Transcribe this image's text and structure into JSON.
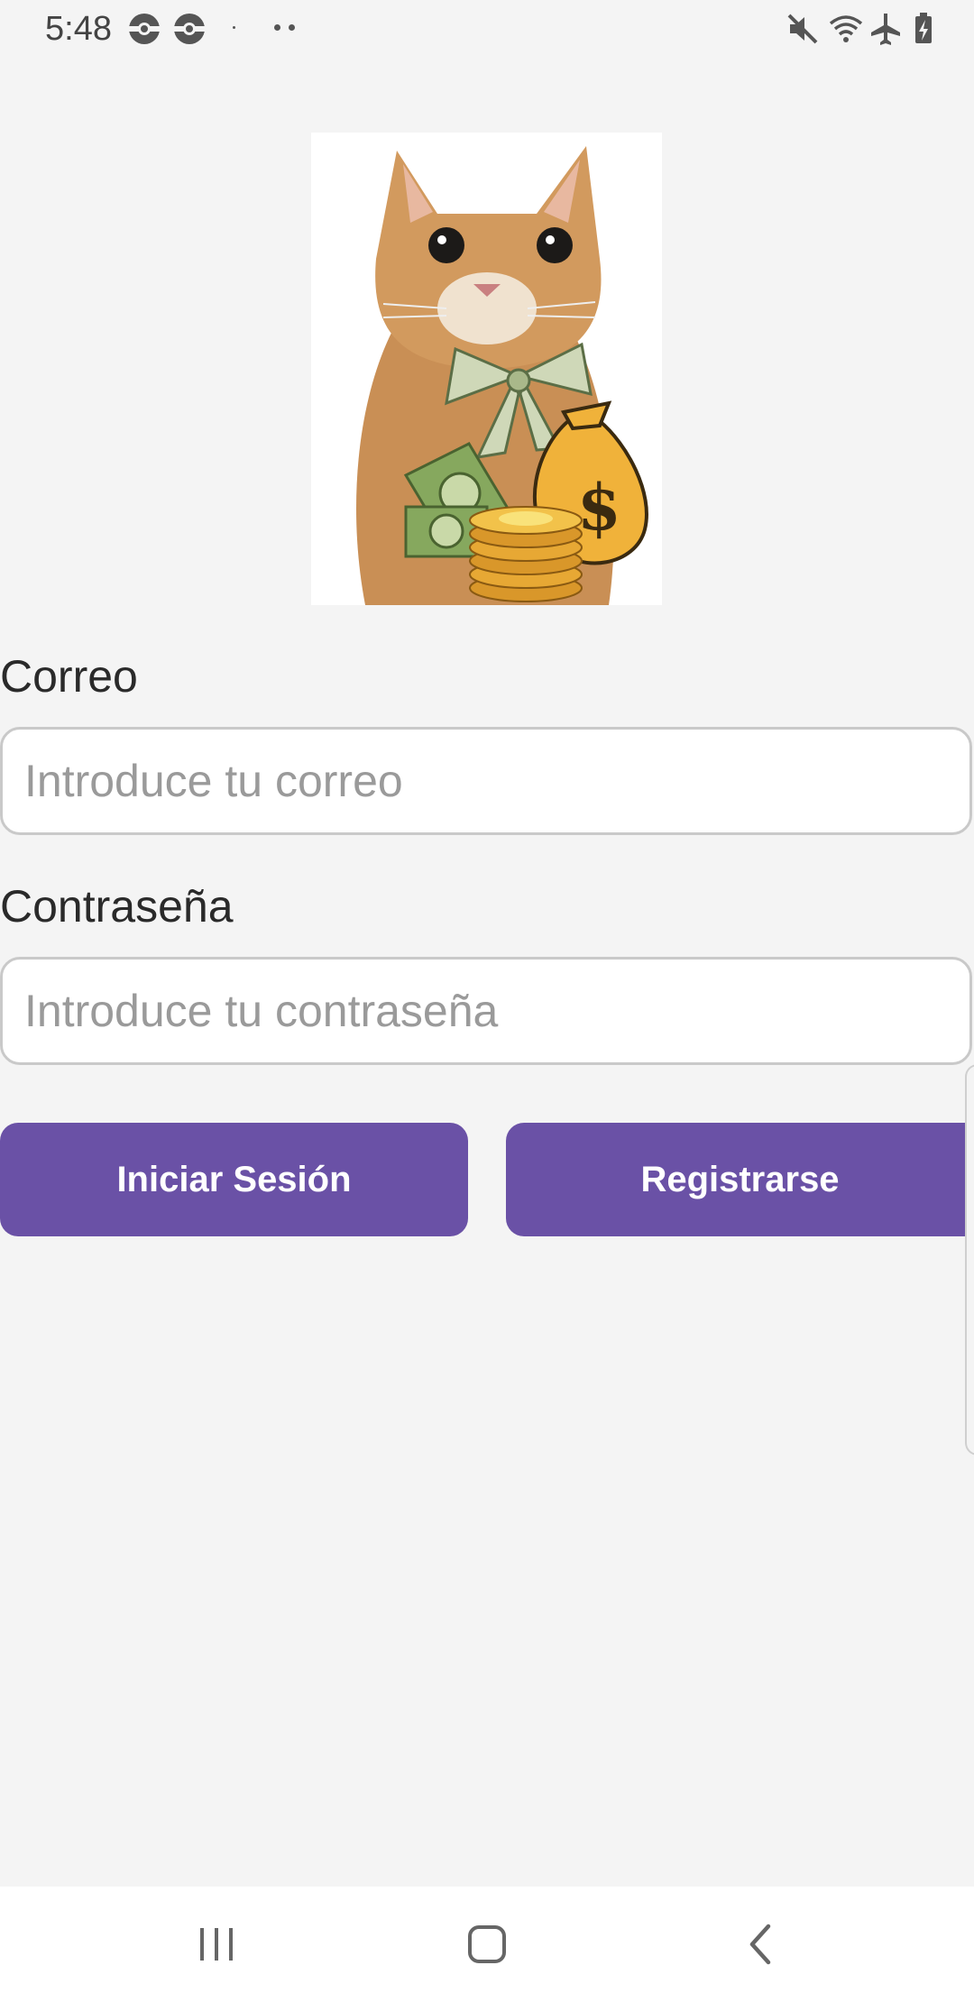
{
  "status_bar": {
    "time": "5:48",
    "left_icons": [
      "pokeball-icon",
      "pokeball-icon",
      "dot-icon",
      "more-dots-icon"
    ],
    "right_icons": [
      "mute-icon",
      "wifi-icon",
      "airplane-mode-icon",
      "battery-charging-icon"
    ]
  },
  "hero": {
    "icon": "cat-with-money-image"
  },
  "form": {
    "email": {
      "label": "Correo",
      "placeholder": "Introduce tu correo",
      "value": ""
    },
    "password": {
      "label": "Contraseña",
      "placeholder": "Introduce tu contraseña",
      "value": ""
    }
  },
  "buttons": {
    "login_label": "Iniciar Sesión",
    "register_label": "Registrarse"
  },
  "colors": {
    "accent": "#6a51a6",
    "background": "#f4f4f4",
    "input_border": "#c9c9c9"
  },
  "nav_bar": {
    "icons": [
      "recent-apps-icon",
      "home-icon",
      "back-icon"
    ]
  }
}
